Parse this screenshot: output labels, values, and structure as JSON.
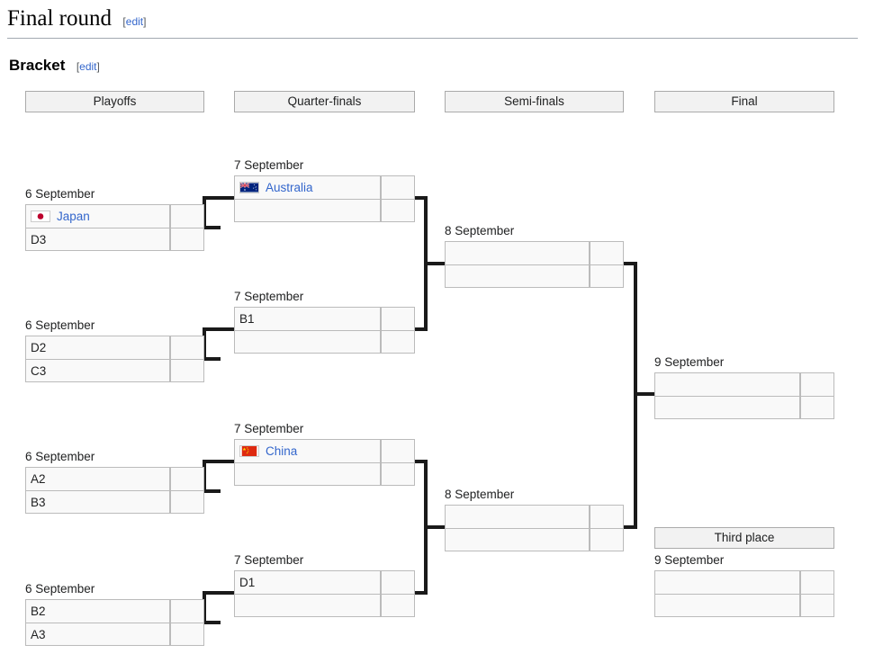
{
  "page": {
    "section_heading": "Final round",
    "subsection_heading": "Bracket",
    "edit_label": "edit",
    "bracket_open": "[",
    "bracket_close": "]"
  },
  "rounds": [
    {
      "label": "Playoffs"
    },
    {
      "label": "Quarter-finals"
    },
    {
      "label": "Semi-finals"
    },
    {
      "label": "Final"
    }
  ],
  "third_place_header": "Third place",
  "matches": {
    "playoff_1": {
      "date": "6 September",
      "team1": {
        "name": "Japan",
        "flag": "japan-flag",
        "is_link": true,
        "score": ""
      },
      "team2": {
        "name": "D3",
        "flag": "",
        "is_link": false,
        "score": ""
      }
    },
    "playoff_2": {
      "date": "6 September",
      "team1": {
        "name": "D2",
        "flag": "",
        "is_link": false,
        "score": ""
      },
      "team2": {
        "name": "C3",
        "flag": "",
        "is_link": false,
        "score": ""
      }
    },
    "playoff_3": {
      "date": "6 September",
      "team1": {
        "name": "A2",
        "flag": "",
        "is_link": false,
        "score": ""
      },
      "team2": {
        "name": "B3",
        "flag": "",
        "is_link": false,
        "score": ""
      }
    },
    "playoff_4": {
      "date": "6 September",
      "team1": {
        "name": "B2",
        "flag": "",
        "is_link": false,
        "score": ""
      },
      "team2": {
        "name": "A3",
        "flag": "",
        "is_link": false,
        "score": ""
      }
    },
    "qf_1": {
      "date": "7 September",
      "team1": {
        "name": "Australia",
        "flag": "australia-flag",
        "is_link": true,
        "score": ""
      },
      "team2": {
        "name": "",
        "flag": "",
        "is_link": false,
        "score": ""
      }
    },
    "qf_2": {
      "date": "7 September",
      "team1": {
        "name": "B1",
        "flag": "",
        "is_link": false,
        "score": ""
      },
      "team2": {
        "name": "",
        "flag": "",
        "is_link": false,
        "score": ""
      }
    },
    "qf_3": {
      "date": "7 September",
      "team1": {
        "name": "China",
        "flag": "china-flag",
        "is_link": true,
        "score": ""
      },
      "team2": {
        "name": "",
        "flag": "",
        "is_link": false,
        "score": ""
      }
    },
    "qf_4": {
      "date": "7 September",
      "team1": {
        "name": "D1",
        "flag": "",
        "is_link": false,
        "score": ""
      },
      "team2": {
        "name": "",
        "flag": "",
        "is_link": false,
        "score": ""
      }
    },
    "sf_1": {
      "date": "8 September",
      "team1": {
        "name": "",
        "flag": "",
        "is_link": false,
        "score": ""
      },
      "team2": {
        "name": "",
        "flag": "",
        "is_link": false,
        "score": ""
      }
    },
    "sf_2": {
      "date": "8 September",
      "team1": {
        "name": "",
        "flag": "",
        "is_link": false,
        "score": ""
      },
      "team2": {
        "name": "",
        "flag": "",
        "is_link": false,
        "score": ""
      }
    },
    "final": {
      "date": "9 September",
      "team1": {
        "name": "",
        "flag": "",
        "is_link": false,
        "score": ""
      },
      "team2": {
        "name": "",
        "flag": "",
        "is_link": false,
        "score": ""
      }
    },
    "third_place": {
      "date": "9 September",
      "team1": {
        "name": "",
        "flag": "",
        "is_link": false,
        "score": ""
      },
      "team2": {
        "name": "",
        "flag": "",
        "is_link": false,
        "score": ""
      }
    }
  },
  "colors": {
    "link": "#3366cc",
    "cell_bg": "#f9f9f9",
    "cell_border": "#bbbbbb",
    "header_bg": "#f2f2f2",
    "header_border": "#aaaaaa",
    "connector": "#1a1a1a",
    "rule": "#a2a9b1"
  }
}
